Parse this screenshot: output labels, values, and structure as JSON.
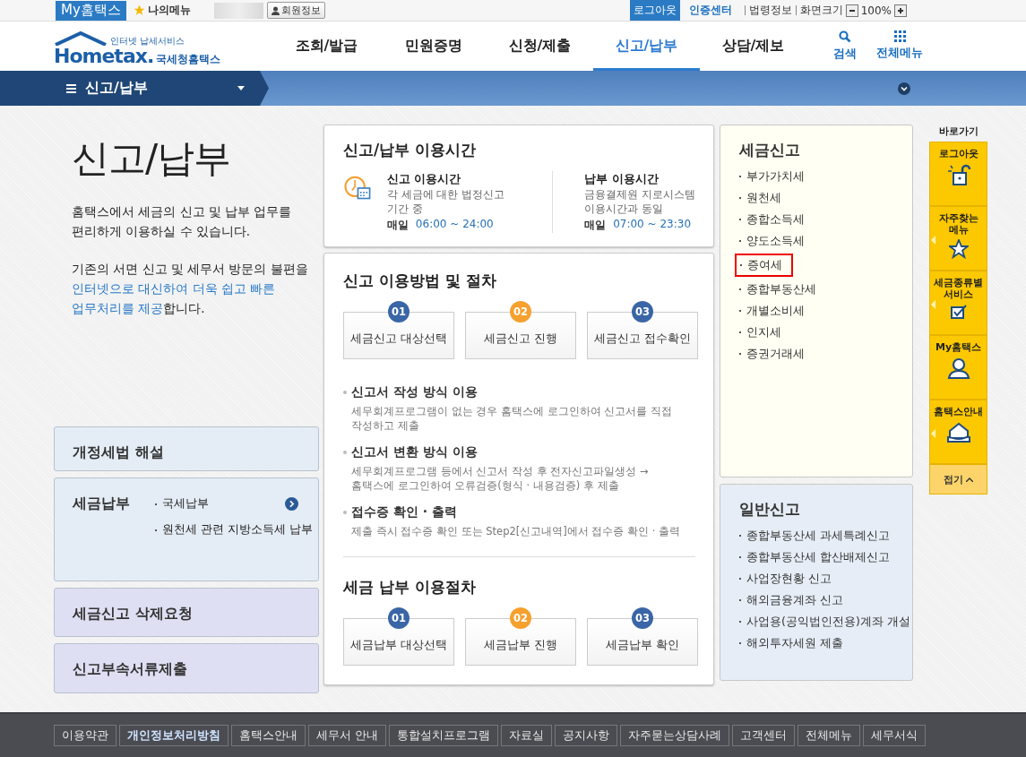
{
  "top_bar": {
    "brand": "My홈택스",
    "my_menu": "나의메뉴",
    "member_info": "회원정보",
    "logout": "로그아웃",
    "cert_center": "인증센터",
    "law_info": "법령정보",
    "screen_size": "화면크기",
    "zoom": "100%"
  },
  "header": {
    "logo_tagline": "인터넷 납세서비스",
    "logo_word": "Hometax.",
    "logo_name": "국세청홈택스",
    "nav": [
      {
        "label": "조회/발급",
        "selected": false
      },
      {
        "label": "민원증명",
        "selected": false
      },
      {
        "label": "신청/제출",
        "selected": false
      },
      {
        "label": "신고/납부",
        "selected": true
      },
      {
        "label": "상담/제보",
        "selected": false
      }
    ],
    "search": "검색",
    "all_menu": "전체메뉴"
  },
  "breadcrumb": {
    "label": "신고/납부"
  },
  "intro": {
    "title": "신고/납부",
    "paragraph_1": [
      "홈택스에서 세금의 신고 및 납부 업무를",
      "편리하게 이용하실 수 있습니다."
    ],
    "paragraph_2": [
      [
        {
          "text": "기존의 서면 신고 및 세무서 방문의 불편을",
          "accent": false
        }
      ],
      [
        {
          "text": "인터넷으로 대신하여 더욱 쉽고 빠른",
          "accent": true
        }
      ],
      [
        {
          "text": "업무처리를 제공",
          "accent": true
        },
        {
          "text": "합니다.",
          "accent": false
        }
      ]
    ]
  },
  "left_cards": [
    {
      "title": "개정세법 해설",
      "color": "#e4ecf5"
    },
    {
      "title": "세금납부",
      "color": "#e4ecf5",
      "links": [
        {
          "label": "국세납부",
          "arrow": true
        },
        {
          "label": "원천세 관련 지방소득세 납부",
          "arrow": false
        }
      ]
    },
    {
      "title": "세금신고 삭제요청",
      "color": "#dedff2"
    },
    {
      "title": "신고부속서류제출",
      "color": "#dedff2"
    }
  ],
  "hours": {
    "title": "신고/납부 이용시간",
    "columns": [
      {
        "title": "신고 이용시간",
        "lines": [
          "각 세금에 대한 법정신고",
          "기간 중"
        ],
        "daily": "매일",
        "time": "06:00 ~ 24:00"
      },
      {
        "title": "납부 이용시간",
        "lines": [
          "금융결제원 지로시스템",
          "이용시간과 동일"
        ],
        "daily": "매일",
        "time": "07:00 ~ 23:30"
      }
    ]
  },
  "procedure": {
    "title": "신고 이용방법 및 절차",
    "steps": [
      {
        "number": "01",
        "label": "세금신고 대상선택",
        "color": "#3a66a6"
      },
      {
        "number": "02",
        "label": "세금신고 진행",
        "color": "#f6a02e"
      },
      {
        "number": "03",
        "label": "세금신고 접수확인",
        "color": "#3a66a6"
      }
    ],
    "methods": [
      {
        "title": "신고서 작성 방식 이용",
        "lines": [
          "세무회계프로그램이 없는 경우 홈택스에 로그인하여 신고서를 직접",
          "작성하고 제출"
        ]
      },
      {
        "title": "신고서 변환 방식 이용",
        "lines": [
          "세무회계프로그램 등에서 신고서 작성 후 전자신고파일생성 →",
          "홈택스에 로그인하여 오류검증(형식 · 내용검증) 후 제출"
        ]
      },
      {
        "title": "접수증 확인 · 출력",
        "lines": [
          "제출 즉시 접수증 확인 또는 Step2[신고내역]에서 접수증 확인 · 출력"
        ]
      }
    ],
    "payment_title": "세금 납부 이용절차",
    "payment_steps": [
      {
        "number": "01",
        "label": "세금납부 대상선택",
        "color": "#3a66a6"
      },
      {
        "number": "02",
        "label": "세금납부 진행",
        "color": "#f6a02e"
      },
      {
        "number": "03",
        "label": "세금납부 확인",
        "color": "#3a66a6"
      }
    ]
  },
  "tax_filing": {
    "title": "세금신고",
    "color": "#fffff3",
    "items": [
      {
        "label": "부가가치세",
        "highlighted": false
      },
      {
        "label": "원천세",
        "highlighted": false
      },
      {
        "label": "종합소득세",
        "highlighted": false
      },
      {
        "label": "양도소득세",
        "highlighted": false
      },
      {
        "label": "증여세",
        "highlighted": true
      },
      {
        "label": "종합부동산세",
        "highlighted": false
      },
      {
        "label": "개별소비세",
        "highlighted": false
      },
      {
        "label": "인지세",
        "highlighted": false
      },
      {
        "label": "증권거래세",
        "highlighted": false
      }
    ]
  },
  "general_filing": {
    "title": "일반신고",
    "color": "#e6edf6",
    "items": [
      {
        "label": "종합부동산세 과세특례신고",
        "highlighted": false
      },
      {
        "label": "종합부동산세 합산배제신고",
        "highlighted": false
      },
      {
        "label": "사업장현황 신고",
        "highlighted": false
      },
      {
        "label": "해외금융계좌 신고",
        "highlighted": false
      },
      {
        "label": "사업용(공익법인전용)계좌 개설",
        "highlighted": false
      },
      {
        "label": "해외투자세원 제출",
        "highlighted": false
      }
    ]
  },
  "quick_bar": {
    "title": "바로가기",
    "items": [
      {
        "kind": "lock",
        "lines": [
          "로그아웃"
        ],
        "pointer": false
      },
      {
        "kind": "star",
        "lines": [
          "자주찾는",
          "메뉴"
        ],
        "pointer": true
      },
      {
        "kind": "check",
        "lines": [
          "세금종류별",
          "서비스"
        ],
        "pointer": true
      },
      {
        "kind": "person",
        "lines": [
          "My홈택스"
        ],
        "pointer": false
      },
      {
        "kind": "house",
        "lines": [
          "홈택스안내"
        ],
        "pointer": true
      }
    ],
    "collapse": "접기"
  },
  "footer": {
    "links": [
      {
        "label": "이용약관",
        "emphasized": false
      },
      {
        "label": "개인정보처리방침",
        "emphasized": true
      },
      {
        "label": "홈택스안내",
        "emphasized": false
      },
      {
        "label": "세무서 안내",
        "emphasized": false
      },
      {
        "label": "통합설치프로그램",
        "emphasized": false
      },
      {
        "label": "자료실",
        "emphasized": false
      },
      {
        "label": "공지사항",
        "emphasized": false
      },
      {
        "label": "자주묻는상담사례",
        "emphasized": false
      },
      {
        "label": "고객센터",
        "emphasized": false
      },
      {
        "label": "전체메뉴",
        "emphasized": false
      },
      {
        "label": "세무서식",
        "emphasized": false
      }
    ]
  }
}
